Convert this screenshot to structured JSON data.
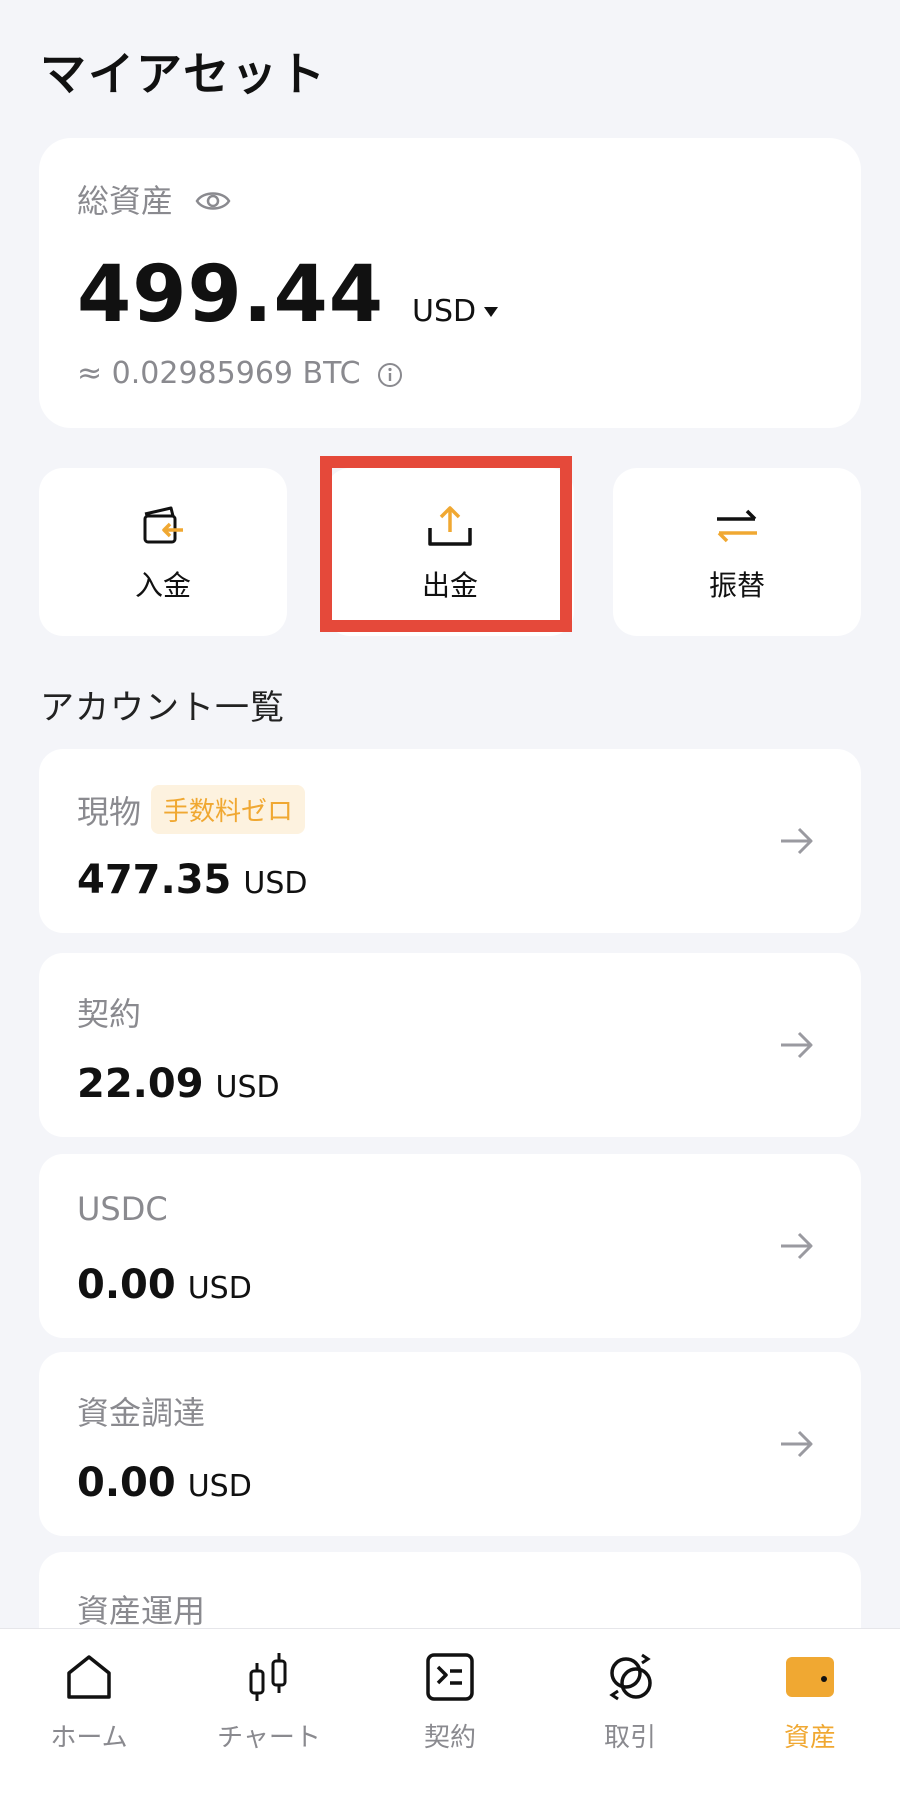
{
  "header": {
    "title": "マイアセット"
  },
  "total": {
    "label": "総資産",
    "value": "499.44",
    "currency": "USD",
    "btc_equivalent": "≈ 0.02985969 BTC"
  },
  "actions": {
    "deposit_label": "入金",
    "withdraw_label": "出金",
    "transfer_label": "振替"
  },
  "accounts_section": {
    "title": "アカウント一覧",
    "items": [
      {
        "name": "現物",
        "badge": "手数料ゼロ",
        "value": "477.35",
        "unit": "USD"
      },
      {
        "name": "契約",
        "value": "22.09",
        "unit": "USD"
      },
      {
        "name": "USDC",
        "value": "0.00",
        "unit": "USD"
      },
      {
        "name": "資金調達",
        "value": "0.00",
        "unit": "USD"
      },
      {
        "name": "資産運用"
      }
    ]
  },
  "bottom_nav": {
    "items": [
      {
        "label": "ホーム",
        "icon": "home-icon"
      },
      {
        "label": "チャート",
        "icon": "candlestick-icon"
      },
      {
        "label": "契約",
        "icon": "contract-icon"
      },
      {
        "label": "取引",
        "icon": "exchange-icon"
      },
      {
        "label": "資産",
        "icon": "wallet-icon",
        "active": true
      }
    ]
  },
  "colors": {
    "accent": "#f0a832",
    "highlight": "#e5493a",
    "background": "#f4f5f9",
    "muted_text": "#8a8a8f"
  }
}
